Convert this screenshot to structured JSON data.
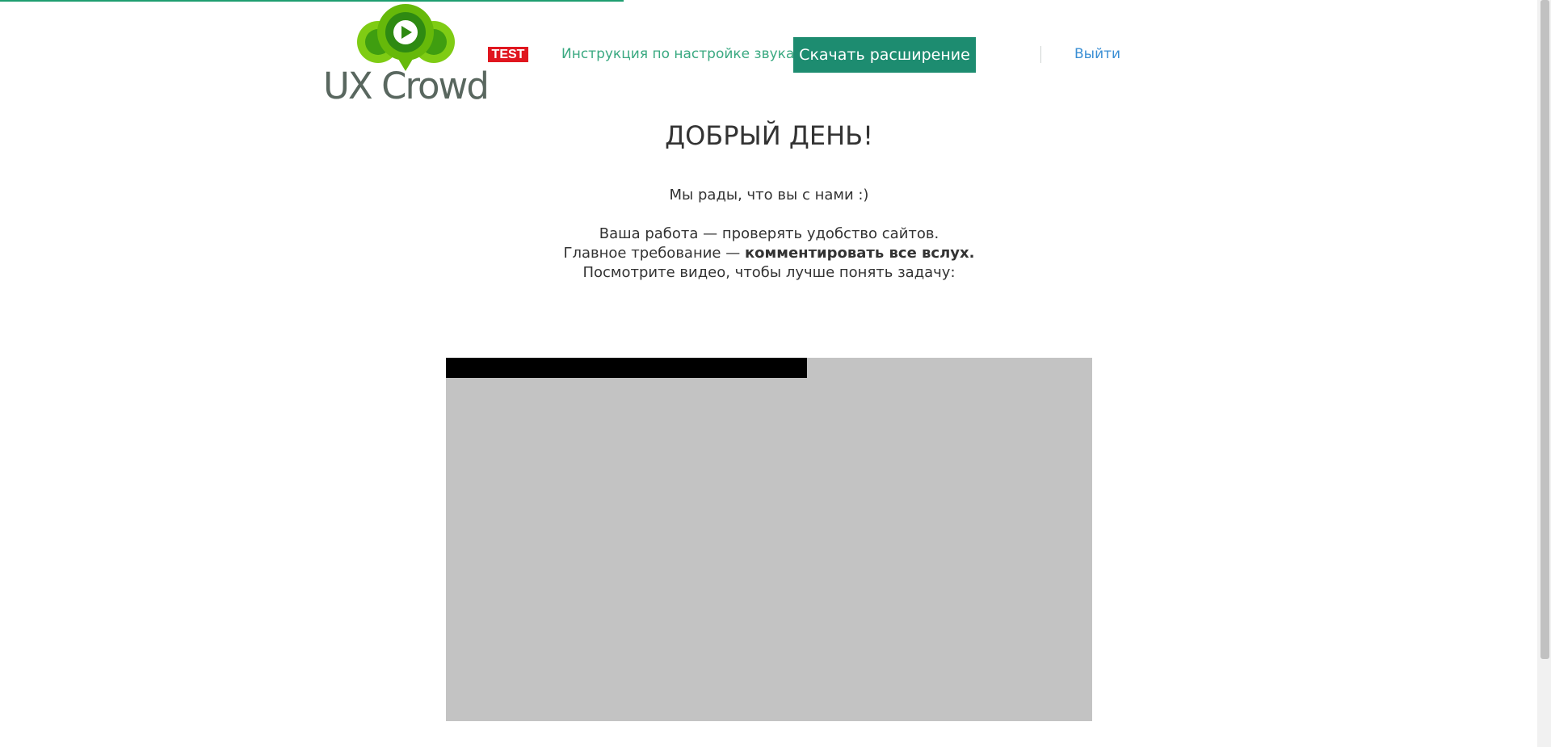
{
  "header": {
    "logo_text": "UX Crowd",
    "env_badge": "TEST",
    "sound_link": "Инструкция по настройке звука",
    "download_button": "Скачать расширение",
    "logout_link": "Выйти"
  },
  "main": {
    "greeting": "ДОБРЫЙ ДЕНЬ!",
    "intro": "Мы рады, что вы с нами :)",
    "line1": "Ваша работа — проверять удобство сайтов.",
    "line2_prefix": "Главное требование — ",
    "line2_bold": "комментировать все вслух.",
    "line3": "Посмотрите видео, чтобы лучше понять задачу:"
  },
  "colors": {
    "accent": "#1d8c70",
    "link_green": "#3aa981",
    "link_blue": "#3b8fd4",
    "badge_red": "#e0161f",
    "logo_green": "#78c800"
  }
}
